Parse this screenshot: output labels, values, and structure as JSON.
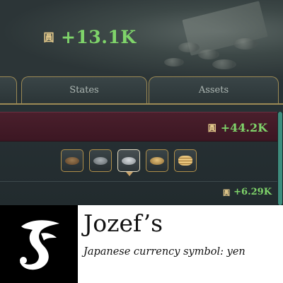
{
  "top_income": {
    "currency_icon": "yen-icon",
    "symbol": "圓",
    "value": "+13.1K"
  },
  "tabs": [
    {
      "label": ""
    },
    {
      "label": "States"
    },
    {
      "label": "Assets"
    }
  ],
  "section_income": {
    "symbol": "圓",
    "value": "+44.2K"
  },
  "filters": [
    {
      "icon": "wood-pile-icon",
      "color": "#7a5a3c"
    },
    {
      "icon": "grey-coins-icon",
      "color": "#8b9296"
    },
    {
      "icon": "silver-coins-icon",
      "color": "#b7bcc0",
      "selected": true
    },
    {
      "icon": "gold-coins-icon",
      "color": "#c9a25c"
    },
    {
      "icon": "gold-stack-icon",
      "color": "#d1a760"
    }
  ],
  "row_income": {
    "symbol": "圓",
    "value": "+6.29K"
  },
  "colors": {
    "income_green": "#7fd46a",
    "frame_gold": "#9c8a55",
    "banner_maroon": "#4a1f2c",
    "scroll_teal": "#3e8d7d"
  },
  "banner": {
    "brand": "Jozef’s",
    "caption": "Japanese currency symbol: yen",
    "logo_icon": "jozefs-logo-icon"
  }
}
